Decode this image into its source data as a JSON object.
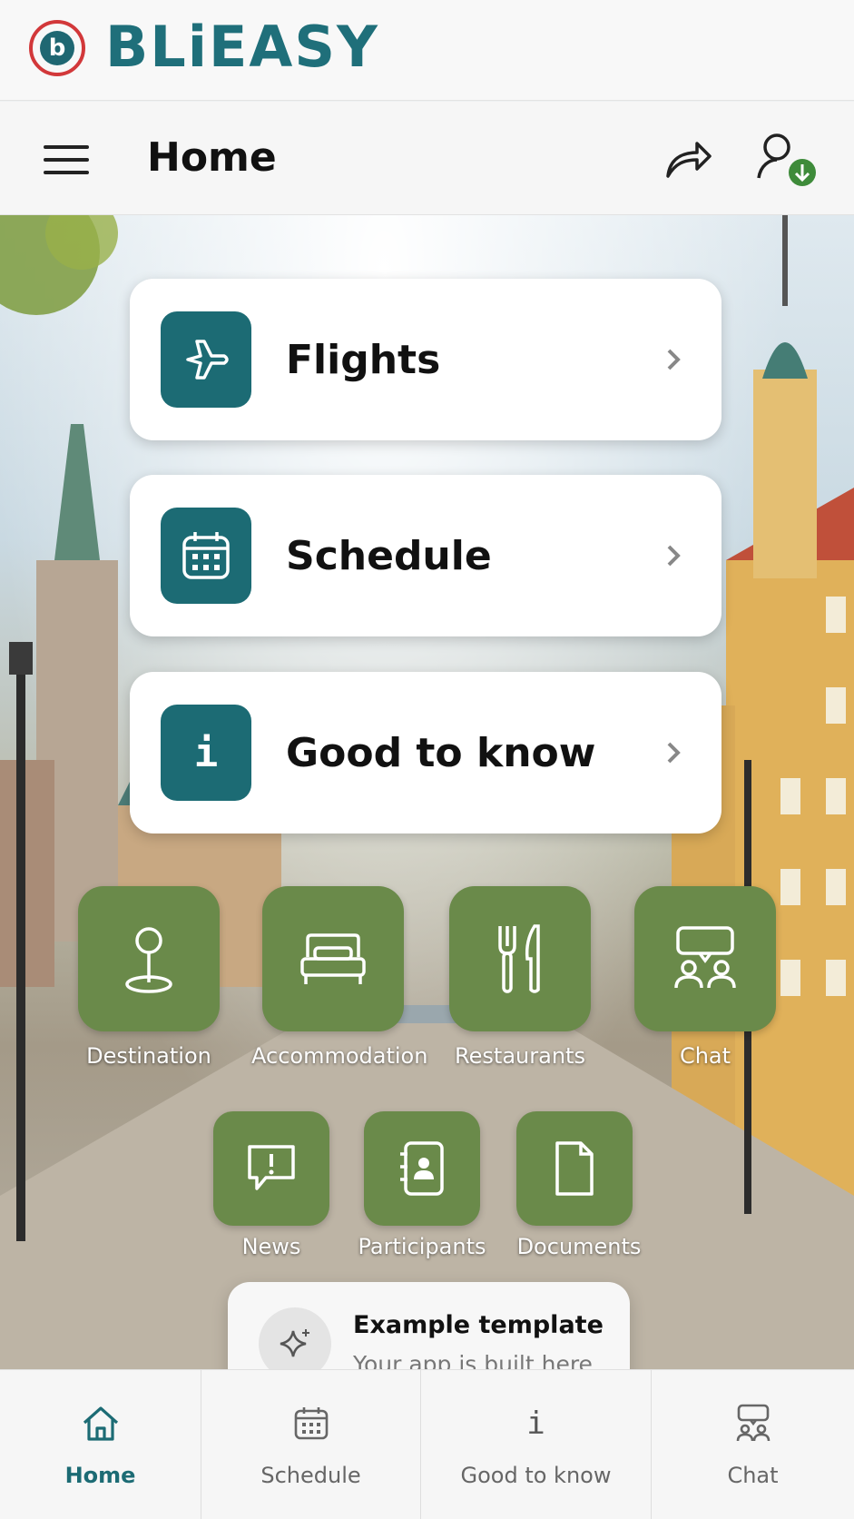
{
  "brand": {
    "logo_letter": "b",
    "name": "BLiEASY"
  },
  "appbar": {
    "title": "Home"
  },
  "cards": [
    {
      "label": "Flights",
      "icon": "airplane-icon"
    },
    {
      "label": "Schedule",
      "icon": "calendar-icon"
    },
    {
      "label": "Good to know",
      "icon": "info-icon",
      "icon_glyph": "i"
    }
  ],
  "tiles_row1": [
    {
      "label": "Destination",
      "icon": "map-pin-icon"
    },
    {
      "label": "Accommodation",
      "icon": "bed-icon"
    },
    {
      "label": "Restaurants",
      "icon": "cutlery-icon"
    },
    {
      "label": "Chat",
      "icon": "chat-people-icon"
    }
  ],
  "tiles_row2": [
    {
      "label": "News",
      "icon": "news-alert-icon"
    },
    {
      "label": "Participants",
      "icon": "contact-book-icon"
    },
    {
      "label": "Documents",
      "icon": "document-icon"
    }
  ],
  "toast": {
    "title": "Example template",
    "subtitle": "Your app is built here",
    "icon": "sparkle-icon"
  },
  "tabbar": [
    {
      "label": "Home",
      "icon": "home-icon",
      "active": true
    },
    {
      "label": "Schedule",
      "icon": "calendar-icon",
      "active": false
    },
    {
      "label": "Good to know",
      "icon": "info-icon",
      "icon_glyph": "i",
      "active": false
    },
    {
      "label": "Chat",
      "icon": "chat-people-icon",
      "active": false
    }
  ],
  "colors": {
    "teal": "#1c6b74",
    "green_tile": "#6a8a4a",
    "brand_red": "#d2383a"
  }
}
